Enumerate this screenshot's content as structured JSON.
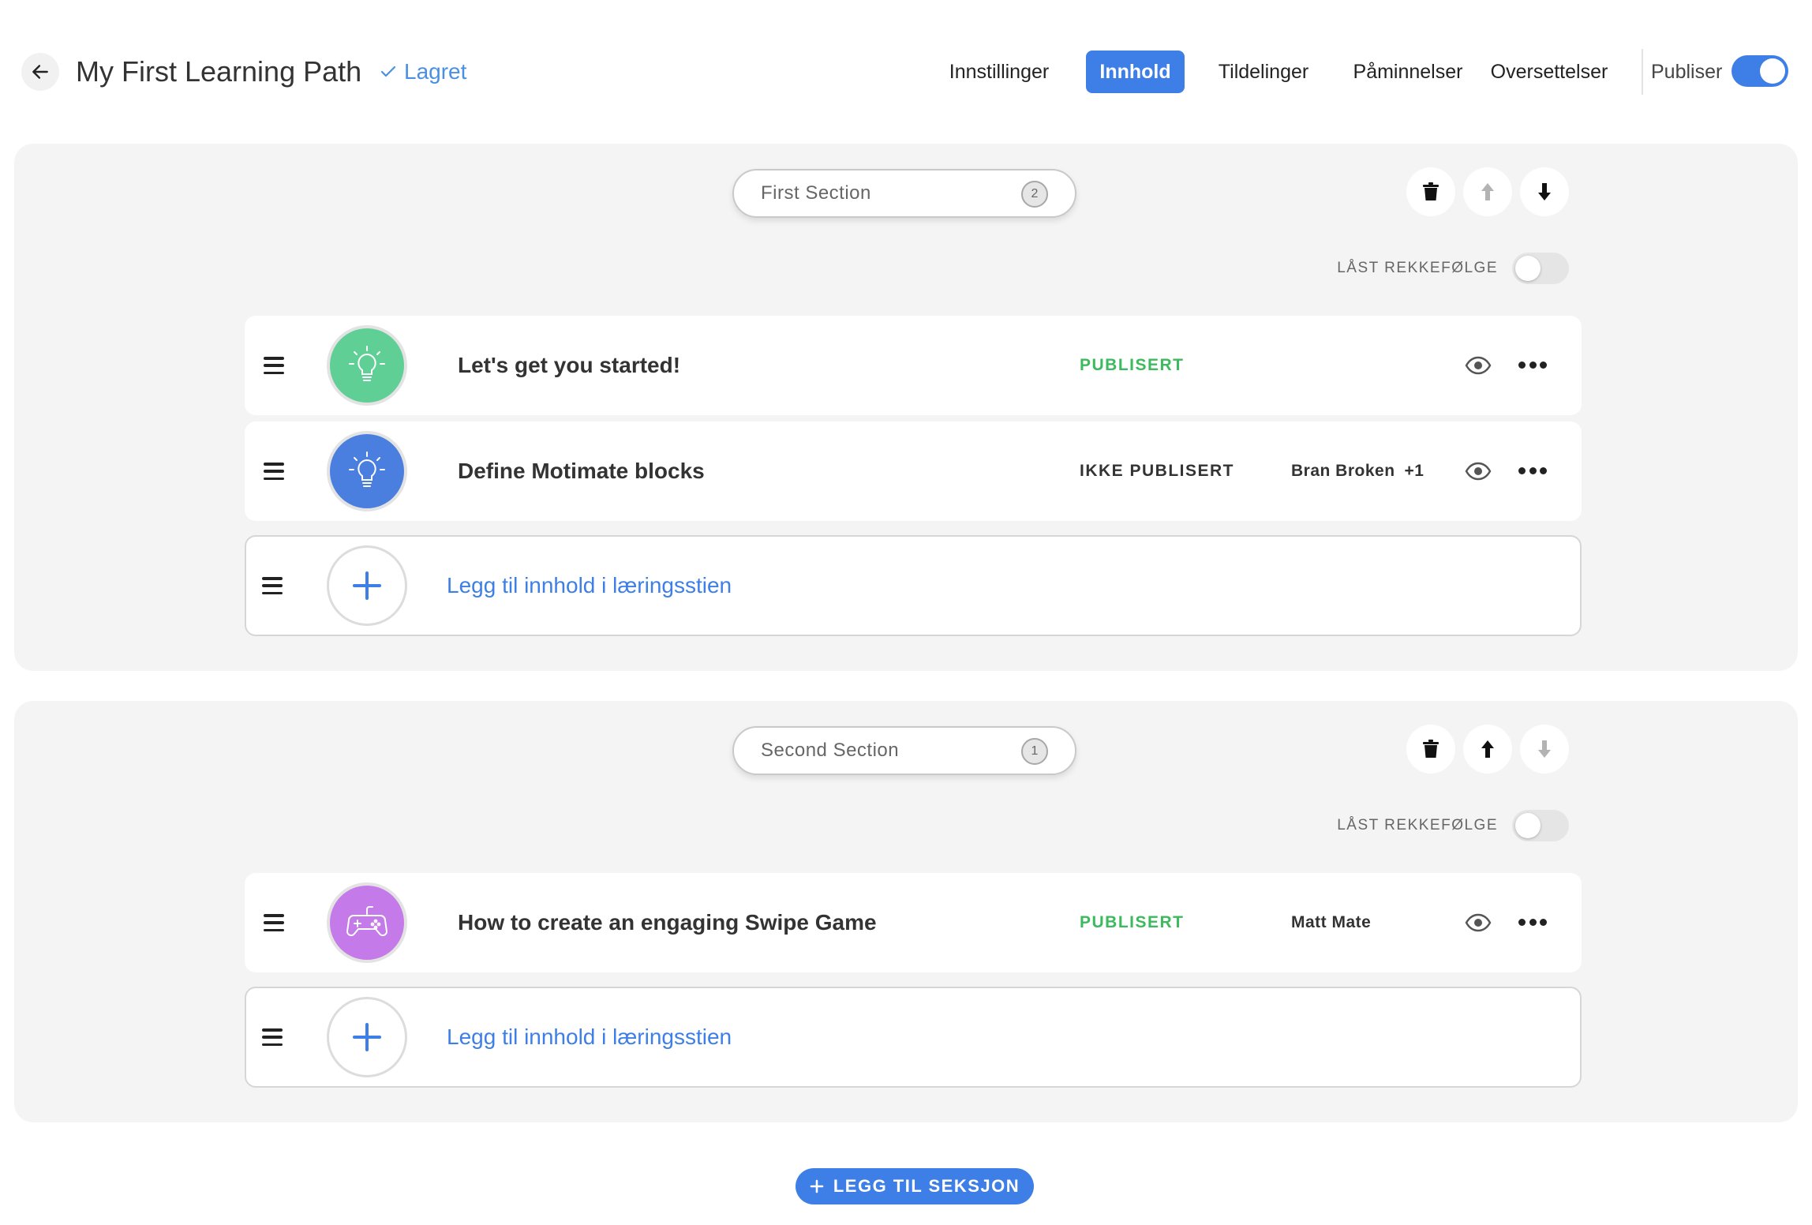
{
  "header": {
    "title": "My First Learning Path",
    "saved_label": "Lagret",
    "tabs": [
      {
        "label": "Innstillinger",
        "active": false
      },
      {
        "label": "Innhold",
        "active": true
      },
      {
        "label": "Tildelinger",
        "active": false
      },
      {
        "label": "Påminnelser",
        "active": false
      },
      {
        "label": "Oversettelser",
        "active": false
      }
    ],
    "publish_label": "Publiser",
    "publish_on": true
  },
  "colors": {
    "accent": "#3d7fe6",
    "published": "#3dba5d",
    "section_bg": "#f4f4f4"
  },
  "sections": [
    {
      "name": "First Section",
      "count": "2",
      "lock_label": "LÅST REKKEFØLGE",
      "locked": false,
      "can_move_up": false,
      "can_move_down": true,
      "items": [
        {
          "title": "Let's get you started!",
          "status": "PUBLISERT",
          "published": true,
          "assignee": "",
          "extra": "",
          "icon": "lightbulb-icon",
          "icon_color": "#5fcf95"
        },
        {
          "title": "Define Motimate blocks",
          "status": "IKKE PUBLISERT",
          "published": false,
          "assignee": "Bran Broken",
          "extra": "+1",
          "icon": "lightbulb-icon",
          "icon_color": "#4a7fe0"
        }
      ],
      "add_label": "Legg til innhold i læringsstien"
    },
    {
      "name": "Second Section",
      "count": "1",
      "lock_label": "LÅST REKKEFØLGE",
      "locked": false,
      "can_move_up": true,
      "can_move_down": false,
      "items": [
        {
          "title": "How to create an engaging Swipe Game",
          "status": "PUBLISERT",
          "published": true,
          "assignee": "Matt Mate",
          "extra": "",
          "icon": "gamepad-icon",
          "icon_color": "#c47ae8"
        }
      ],
      "add_label": "Legg til innhold i læringsstien"
    }
  ],
  "footer": {
    "add_section_label": "LEGG TIL SEKSJON"
  }
}
